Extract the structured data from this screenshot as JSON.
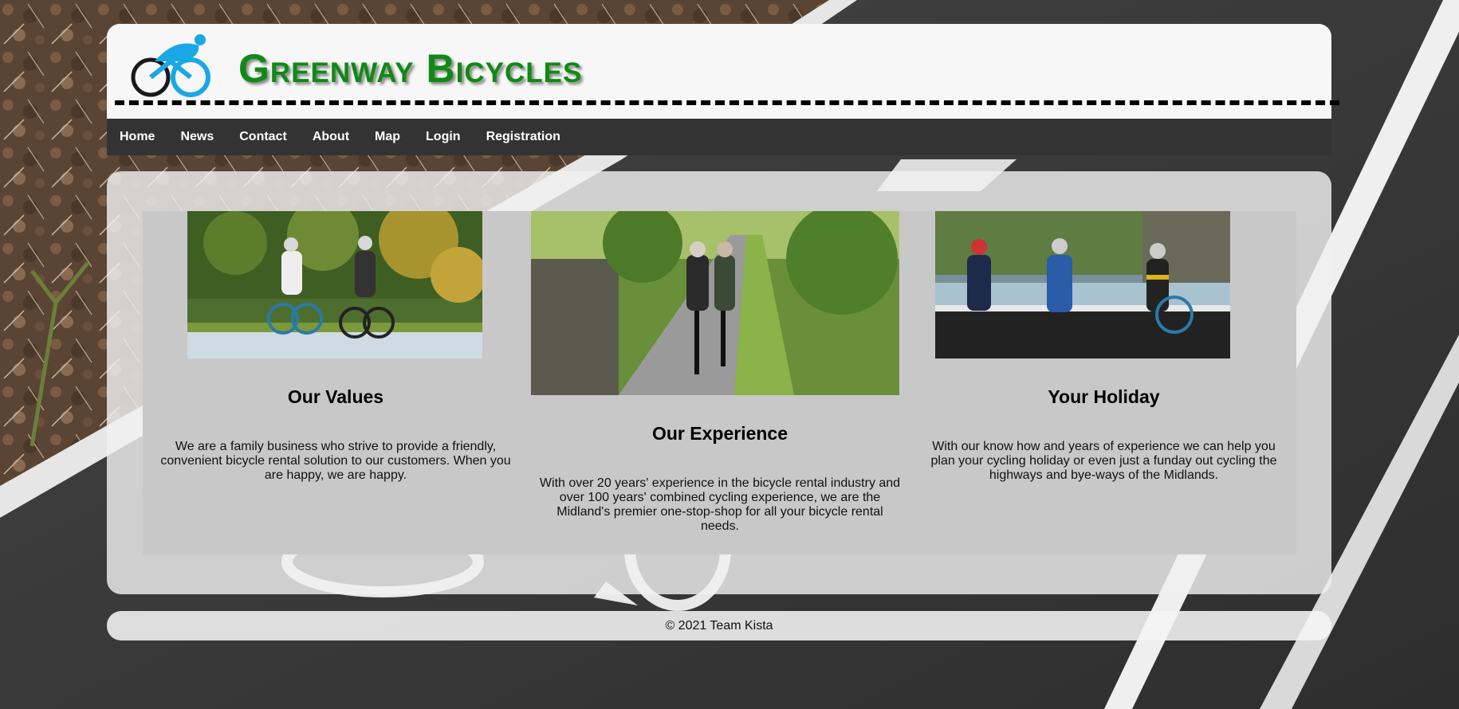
{
  "site": {
    "title": "Greenway Bicycles",
    "brand_color": "#0f8a14",
    "logo_icon": "cyclist-logo-icon"
  },
  "nav": {
    "items": [
      "Home",
      "News",
      "Contact",
      "About",
      "Map",
      "Login",
      "Registration"
    ]
  },
  "features": [
    {
      "heading": "Our Values",
      "text": "We are a family business who strive to provide a friendly, convenient bicycle rental solution to our customers. When you are happy, we are happy.",
      "image": "two-cyclists-road-photo"
    },
    {
      "heading": "Our Experience",
      "text": "With over 20 years' experience in the bicycle rental industry and over 100 years' combined cycling experience, we are the Midland's premier one-stop-shop for all your bicycle rental needs.",
      "image": "couple-cycling-greenway-photo"
    },
    {
      "heading": "Your Holiday",
      "text": "With our know how and years of experience we can help you plan your cycling holiday or even just a funday out cycling the highways and bye-ways of the Midlands.",
      "image": "cyclists-canal-lock-photo"
    }
  ],
  "footer": {
    "text": "© 2021 Team Kista"
  }
}
